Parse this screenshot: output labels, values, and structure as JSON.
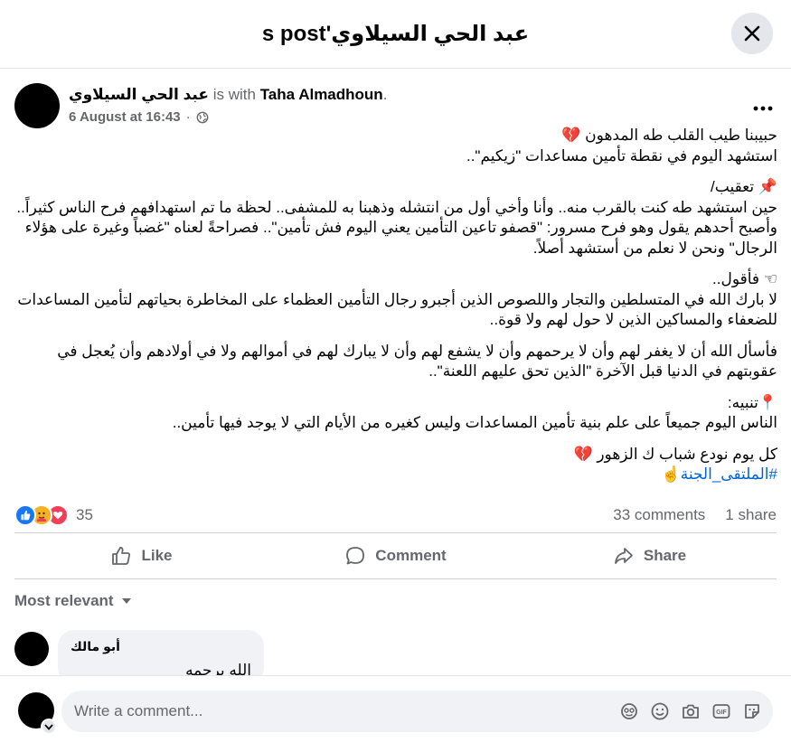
{
  "header": {
    "title": "عبد الحي السيلاوي's post"
  },
  "post": {
    "author": "عبد الحي السيلاوي",
    "with_text": "is with",
    "tagged": "Taha Almadhoun",
    "timestamp": "6 August at 16:43",
    "paragraphs": [
      "حبيبنا طيب القلب طه المدهون 💔\nاستشهد اليوم في نقطة تأمين مساعدات \"زيكيم\"..",
      "📌 تعقيب/\nحين استشهد طه كنت بالقرب منه.. وأنا وأخي أول من انتشله وذهبنا به للمشفى.. لحظة ما تم استهدافهم فرح الناس كثيراً.. وأصبح أحدهم يقول وهو فرح مسرور: \"قصفو تاعين التأمين يعني اليوم فش تأمين\".. فصراحةً لعناه \"غضباً وغيرة على هؤلاء الرجال\" ونحن لا نعلم من أستشهد أصلاً.",
      "☜ فأقول..\nلا بارك الله في المتسلطين والتجار واللصوص الذين أجبرو رجال التأمين العظماء على المخاطرة بحياتهم لتأمين المساعدات للضعفاء والمساكين الذين لا حول لهم ولا قوة..",
      "فأسأل الله أن لا يغفر لهم وأن لا يرحمهم وأن لا يشفع لهم وأن لا يبارك لهم في أموالهم ولا في أولادهم وأن يُعجل في عقوبتهم في الدنيا قبل الآخرة \"الذين تحق عليهم اللعنة\"..",
      "📍تنبيه:\nالناس اليوم جميعاً على علم بنية تأمين المساعدات وليس كغيره من الأيام التي لا يوجد فيها تأمين..",
      "كل يوم نودع شباب ك الزهور 💔"
    ],
    "hashtag": "#الملتقى_الجنة☝️"
  },
  "stats": {
    "reactions_count": "35",
    "comments": "33 comments",
    "shares": "1 share"
  },
  "actions": {
    "like": "Like",
    "comment": "Comment",
    "share": "Share"
  },
  "sort": {
    "label": "Most relevant"
  },
  "comments": [
    {
      "name": "أبو مالك",
      "text": "الله يرحمه"
    }
  ],
  "composer": {
    "placeholder": "Write a comment..."
  },
  "icons": {
    "close": "close-icon",
    "more": "more-horizontal-icon",
    "globe": "globe-icon",
    "like": "thumbs-up-icon",
    "comment": "comment-bubble-icon",
    "share": "share-arrow-icon",
    "sort_caret": "caret-down-icon",
    "reactions": [
      "like-reaction-icon",
      "care-reaction-icon",
      "love-reaction-icon"
    ],
    "composer_tools": [
      "avatar-sticker-icon",
      "emoji-icon",
      "camera-icon",
      "gif-icon",
      "sticker-icon"
    ]
  },
  "colors": {
    "like_blue": "#1877f2",
    "love_red": "#f33e58",
    "care_yellow": "#f7b125",
    "hashtag": "#0064d1",
    "muted": "#65676b"
  }
}
